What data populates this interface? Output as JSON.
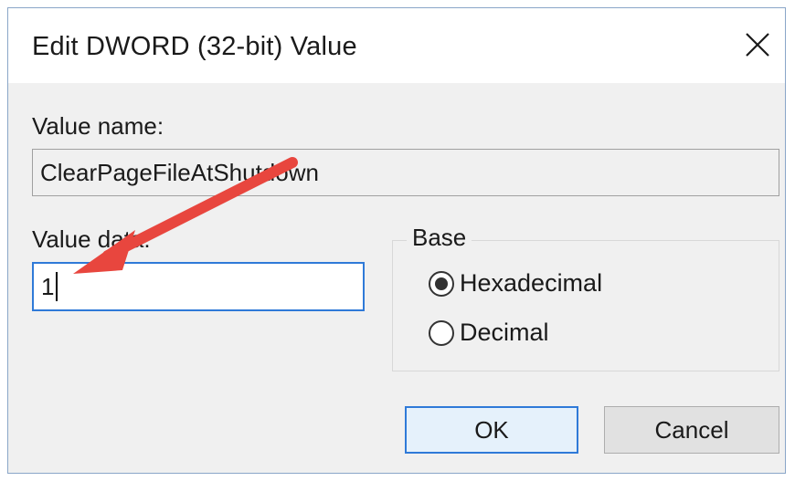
{
  "dialog": {
    "title": "Edit DWORD (32-bit) Value",
    "close_glyph": "✕"
  },
  "value_name": {
    "label": "Value name:",
    "value": "ClearPageFileAtShutdown"
  },
  "value_data": {
    "label": "Value data:",
    "value": "1"
  },
  "base": {
    "legend": "Base",
    "options": [
      {
        "label": "Hexadecimal",
        "selected": true
      },
      {
        "label": "Decimal",
        "selected": false
      }
    ]
  },
  "buttons": {
    "ok": "OK",
    "cancel": "Cancel"
  },
  "annotation": {
    "arrow_color": "#e8463e"
  }
}
